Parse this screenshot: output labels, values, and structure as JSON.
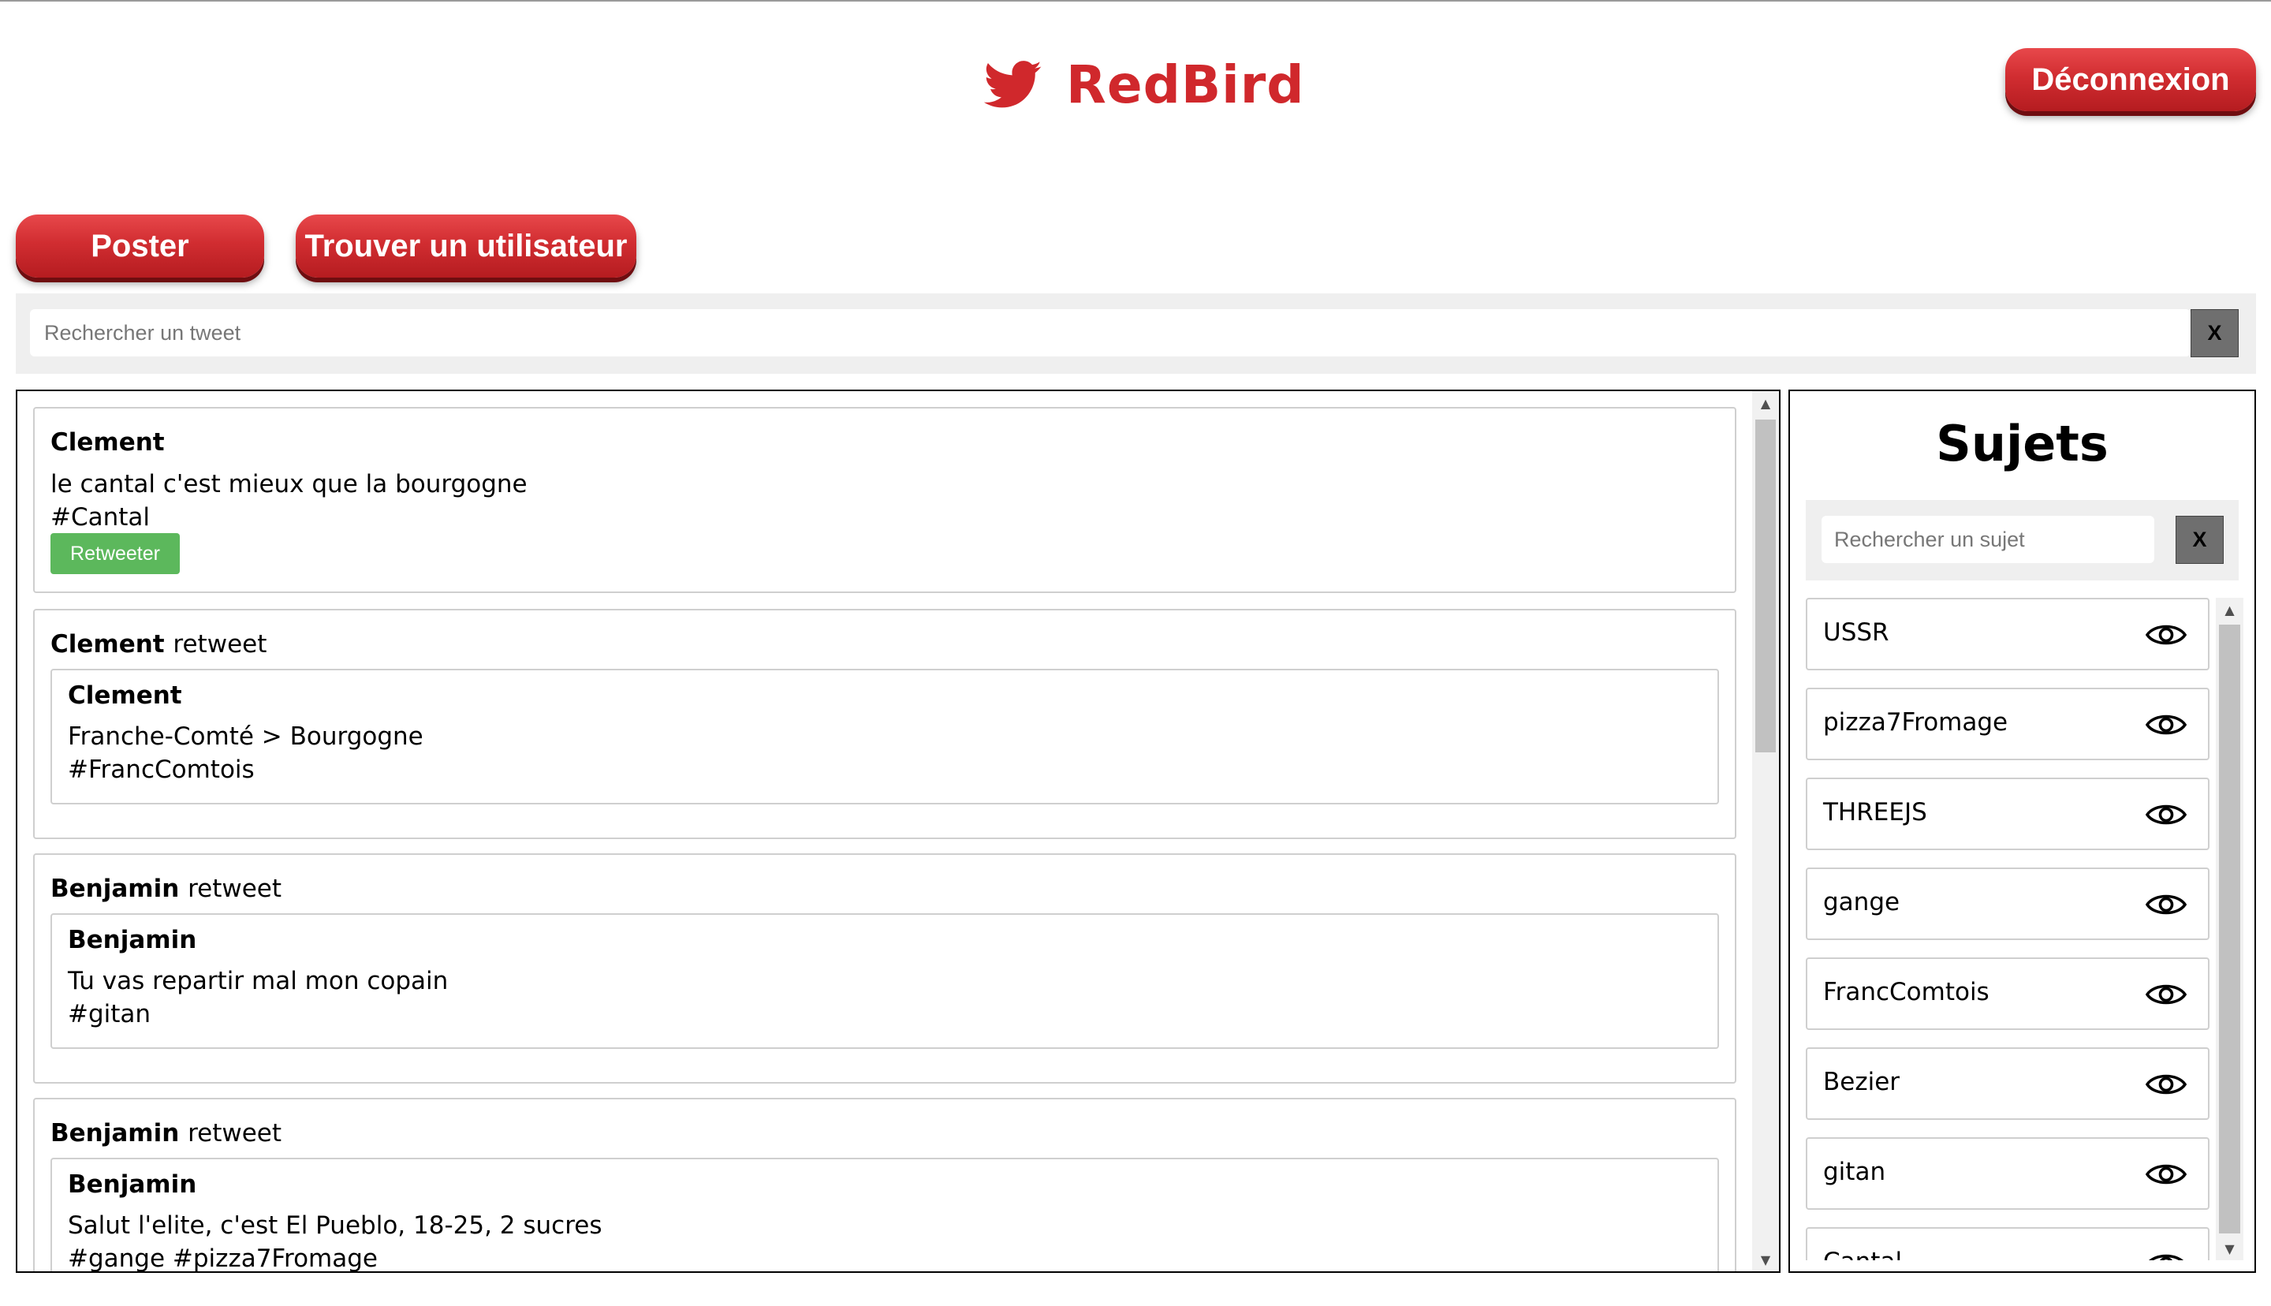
{
  "app": {
    "brand": "RedBird",
    "logo_icon": "twitter-bird-icon",
    "accent_color": "#d0282c",
    "logout_label": "Déconnexion"
  },
  "toolbar": {
    "post_label": "Poster",
    "find_user_label": "Trouver un utilisateur"
  },
  "tweet_search": {
    "placeholder": "Rechercher un tweet",
    "value": "",
    "clear_label": "X"
  },
  "feed": {
    "tweets": [
      {
        "author": "Clement",
        "text": "le cantal c'est mieux que la bourgogne",
        "hashtags": "#Cantal",
        "retweet_label": "Retweeter"
      },
      {
        "author": "Clement",
        "retweet_suffix": "retweet",
        "original": {
          "author": "Clement",
          "text": "Franche-Comté > Bourgogne",
          "hashtags": "#FrancComtois"
        }
      },
      {
        "author": "Benjamin",
        "retweet_suffix": "retweet",
        "original": {
          "author": "Benjamin",
          "text": "Tu vas repartir mal mon copain",
          "hashtags": "#gitan"
        }
      },
      {
        "author": "Benjamin",
        "retweet_suffix": "retweet",
        "original": {
          "author": "Benjamin",
          "text": "Salut l'elite, c'est El Pueblo, 18-25, 2 sucres",
          "hashtags": "#gange #pizza7Fromage"
        }
      }
    ]
  },
  "topics": {
    "title": "Sujets",
    "search_placeholder": "Rechercher un sujet",
    "search_value": "",
    "clear_label": "X",
    "items": [
      {
        "name": "USSR",
        "icon": "eye-icon"
      },
      {
        "name": "pizza7Fromage",
        "icon": "eye-icon"
      },
      {
        "name": "THREEJS",
        "icon": "eye-icon"
      },
      {
        "name": "gange",
        "icon": "eye-icon"
      },
      {
        "name": "FrancComtois",
        "icon": "eye-icon"
      },
      {
        "name": "Bezier",
        "icon": "eye-icon"
      },
      {
        "name": "gitan",
        "icon": "eye-icon"
      },
      {
        "name": "Cantal",
        "icon": "eye-icon"
      }
    ]
  }
}
